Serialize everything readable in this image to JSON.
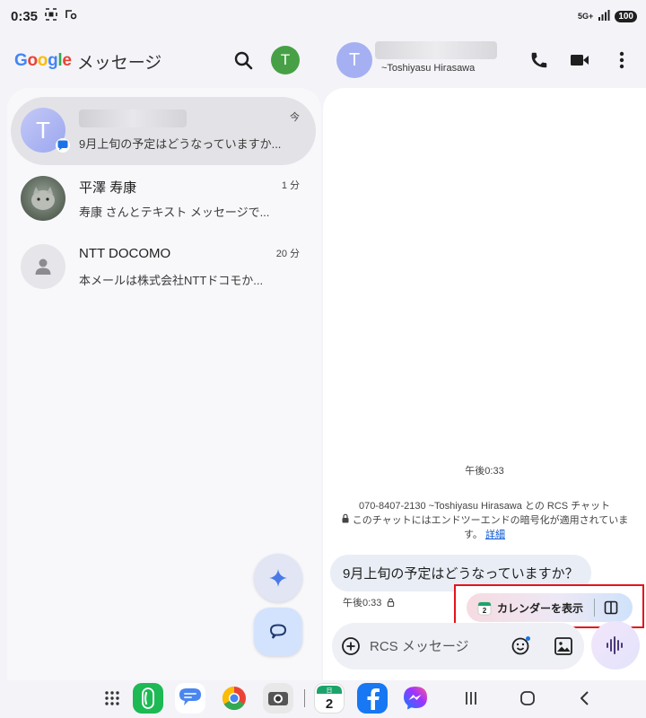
{
  "status_bar": {
    "time": "0:35",
    "network": "5G+",
    "battery": "100"
  },
  "app": {
    "logo_text": "Google",
    "title_text": "メッセージ",
    "profile_initial": "T",
    "logo_colors": [
      "#4285f4",
      "#ea4335",
      "#fbbc05",
      "#4285f4",
      "#34a853",
      "#ea4335"
    ]
  },
  "conversations": [
    {
      "avatar_initial": "T",
      "name": "",
      "name_hidden": true,
      "snippet": "9月上旬の予定はどうなっていますか...",
      "time": "今",
      "selected": true
    },
    {
      "avatar_initial": "",
      "name": "平澤 寿康",
      "snippet": "寿康 さんとテキスト メッセージで...",
      "time": "1 分",
      "selected": false
    },
    {
      "avatar_initial": "",
      "name": "NTT DOCOMO",
      "snippet": "本メールは株式会社NTTドコモか...",
      "time": "20 分",
      "selected": false
    }
  ],
  "chat": {
    "avatar_initial": "T",
    "contact_sub": "~Toshiyasu Hirasawa",
    "date_label": "午後0:33",
    "info_line1": "070-8407-2130 ~Toshiyasu Hirasawa との RCS チャット",
    "info_line2": "このチャットにはエンドツーエンドの暗号化が適用されています。",
    "info_link": "詳細",
    "message_text": "9月上旬の予定はどうなっていますか？",
    "message_time": "午後0:33",
    "suggestion_label": "カレンダーを表示",
    "suggestion_calendar_day": "2",
    "composer_placeholder": "RCS メッセージ"
  },
  "dock": {
    "calendar_label": "日",
    "calendar_day": "2"
  }
}
